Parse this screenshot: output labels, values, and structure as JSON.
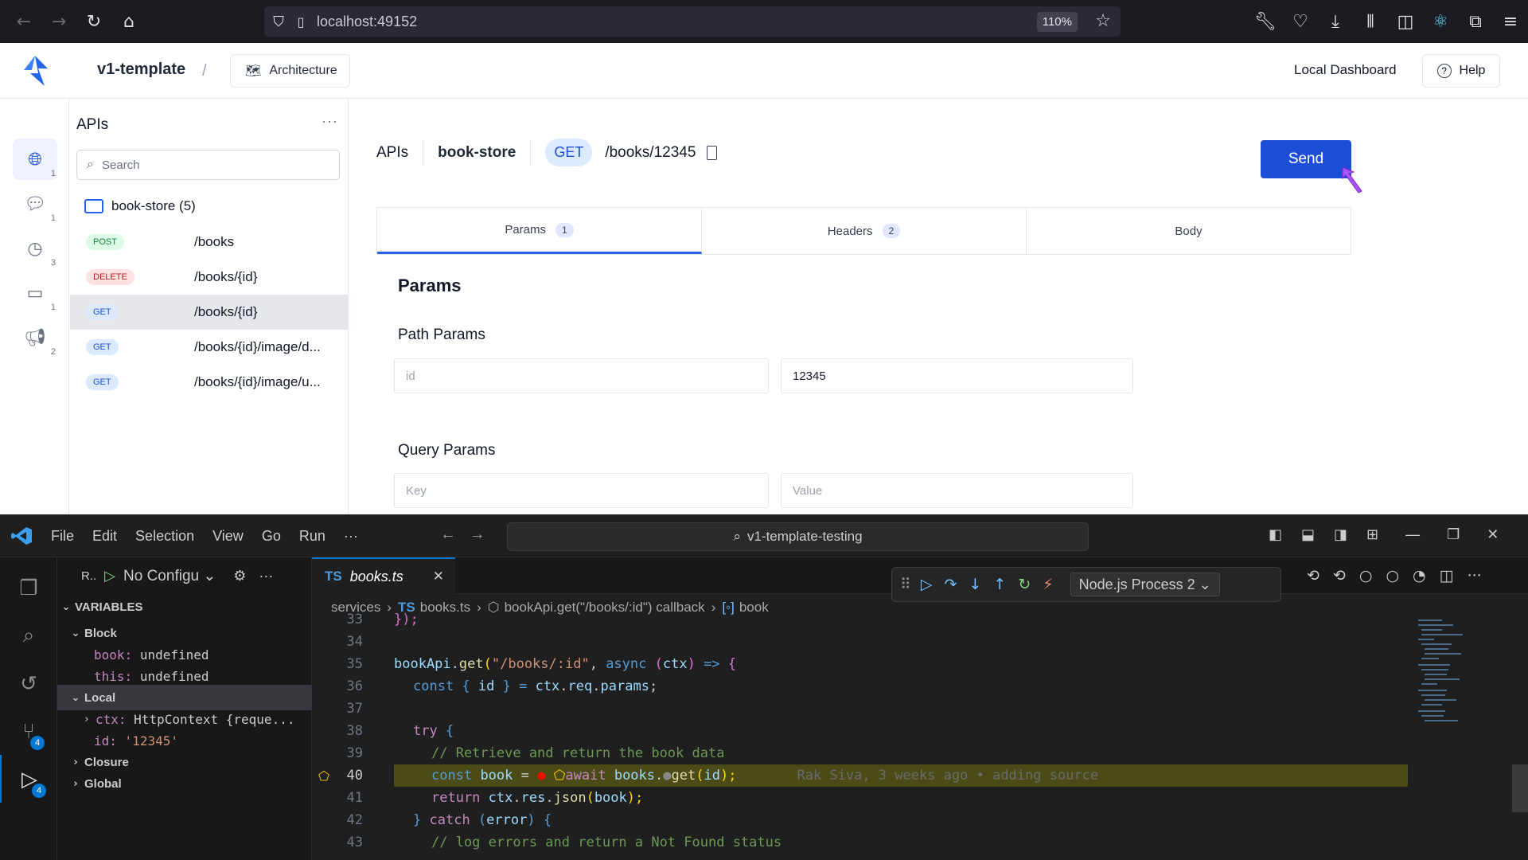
{
  "browser": {
    "url": "localhost:49152",
    "zoom": "110%"
  },
  "app": {
    "project": "v1-template",
    "architecture_label": "Architecture",
    "local_dashboard_label": "Local Dashboard",
    "help_label": "Help",
    "rail": [
      {
        "icon": "globe-icon",
        "count": "1"
      },
      {
        "icon": "chat-icon",
        "count": "1"
      },
      {
        "icon": "clock-icon",
        "count": "3"
      },
      {
        "icon": "archive-icon",
        "count": "1"
      },
      {
        "icon": "megaphone-icon",
        "count": "2"
      }
    ],
    "apis_panel": {
      "title": "APIs",
      "search_placeholder": "Search",
      "folder": "book-store (5)",
      "endpoints": [
        {
          "method": "POST",
          "path": "/books"
        },
        {
          "method": "DELETE",
          "path": "/books/{id}"
        },
        {
          "method": "GET",
          "path": "/books/{id}"
        },
        {
          "method": "GET",
          "path": "/books/{id}/image/d..."
        },
        {
          "method": "GET",
          "path": "/books/{id}/image/u..."
        }
      ]
    },
    "request": {
      "crumb_apis": "APIs",
      "service": "book-store",
      "method": "GET",
      "path": "/books/12345",
      "send_label": "Send",
      "tabs": [
        {
          "label": "Params",
          "count": "1"
        },
        {
          "label": "Headers",
          "count": "2"
        },
        {
          "label": "Body",
          "count": ""
        }
      ],
      "params_heading": "Params",
      "path_params_heading": "Path Params",
      "path_param_name_placeholder": "id",
      "path_param_value": "12345",
      "query_params_heading": "Query Params",
      "query_key_placeholder": "Key",
      "query_value_placeholder": "Value"
    }
  },
  "vscode": {
    "menu": [
      "File",
      "Edit",
      "Selection",
      "View",
      "Go",
      "Run",
      "···"
    ],
    "command_center": "v1-template-testing",
    "run_label": "R..",
    "config_label": "No Configu",
    "variables_heading": "VARIABLES",
    "scopes": {
      "block": "Block",
      "local": "Local",
      "closure": "Closure",
      "global": "Global"
    },
    "vars": {
      "book_name": "book:",
      "book_value": "undefined",
      "this_name": "this:",
      "this_value": "undefined",
      "ctx_name": "ctx:",
      "ctx_value": "HttpContext {reque...",
      "id_name": "id:",
      "id_value": "'12345'"
    },
    "activity_counts": {
      "source_control": "4",
      "run_debug": "4"
    },
    "tab": {
      "lang": "TS",
      "file": "books.ts"
    },
    "process": "Node.js Process 2",
    "breadcrumb": {
      "folder": "services",
      "lang": "TS",
      "file": "books.ts",
      "callback": "bookApi.get(\"/books/:id\") callback",
      "symbol": "book"
    },
    "line_numbers": [
      "33",
      "34",
      "35",
      "36",
      "37",
      "38",
      "39",
      "40",
      "41",
      "42",
      "43"
    ],
    "code": {
      "l33": "});",
      "l35_a": "bookApi",
      "l35_b": ".",
      "l35_c": "get",
      "l35_d": "(",
      "l35_e": "\"/books/:id\"",
      "l35_f": ", ",
      "l35_g": "async",
      "l35_h": " (",
      "l35_i": "ctx",
      "l35_j": ") ",
      "l35_k": "=>",
      "l35_l": " {",
      "l36_a": "const",
      "l36_b": " { ",
      "l36_c": "id",
      "l36_d": " } = ",
      "l36_e": "ctx",
      "l36_f": ".",
      "l36_g": "req",
      "l36_h": ".",
      "l36_i": "params",
      "l36_j": ";",
      "l38_a": "try",
      "l38_b": " {",
      "l39": "// Retrieve and return the book data",
      "l40_a": "const",
      "l40_b": "book",
      "l40_c": " = ",
      "l40_d": "await",
      "l40_e": "books",
      "l40_f": ".",
      "l40_g": "get",
      "l40_h": "(",
      "l40_i": "id",
      "l40_j": ");",
      "l40_blame": "Rak Siva, 3 weeks ago • adding source",
      "l41_a": "return",
      "l41_b": "ctx",
      "l41_c": ".",
      "l41_d": "res",
      "l41_e": ".",
      "l41_f": "json",
      "l41_g": "(",
      "l41_h": "book",
      "l41_i": ");",
      "l42_a": "}",
      "l42_b": "catch",
      "l42_c": " (",
      "l42_d": "error",
      "l42_e": ") {",
      "l43": "// log errors and return a Not Found status"
    }
  }
}
